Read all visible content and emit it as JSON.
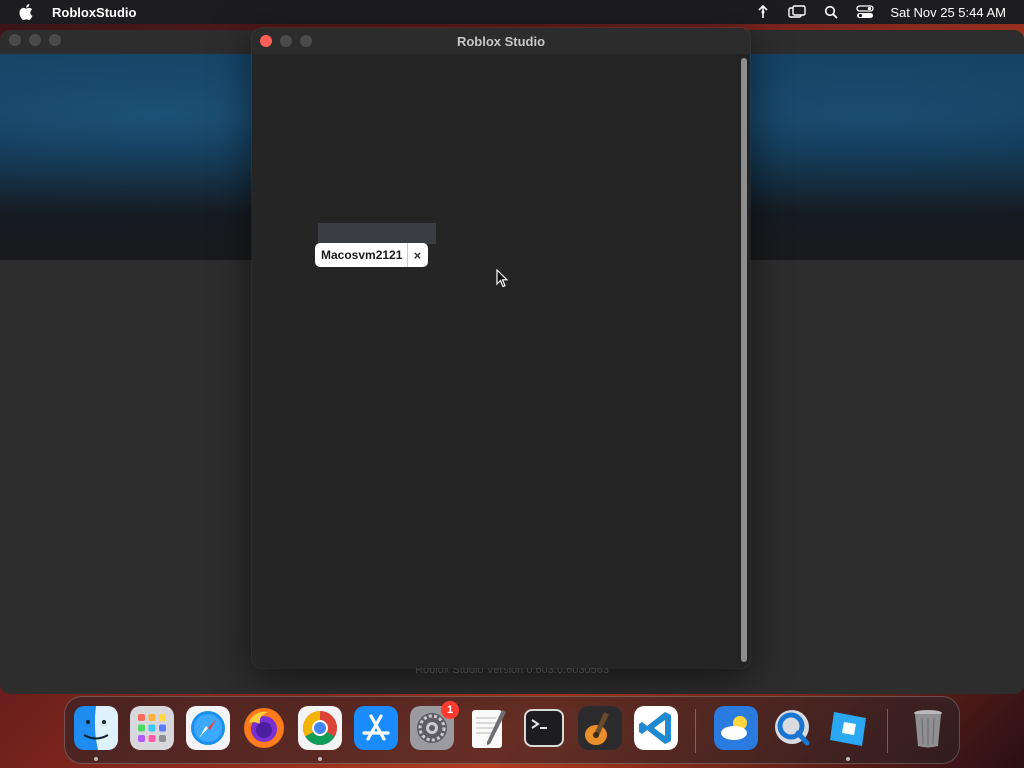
{
  "menubar": {
    "app_name": "RobloxStudio",
    "clock": "Sat Nov 25  5:44 AM",
    "icons": [
      "apple-icon",
      "stats-icon",
      "screen-mirroring-icon",
      "spotlight-search-icon",
      "control-center-icon"
    ]
  },
  "login_window": {
    "title": "Roblox Studio",
    "account_chip": {
      "label": "Macosvm2121",
      "remove_symbol": "×"
    }
  },
  "background_window": {
    "version_text": "Roblox Studio Version 0.603.0.6030563"
  },
  "dock": {
    "apps": [
      {
        "name": "Finder",
        "icon": "finder-icon",
        "running": true
      },
      {
        "name": "Launchpad",
        "icon": "launchpad-icon",
        "running": false
      },
      {
        "name": "Safari",
        "icon": "safari-icon",
        "running": false
      },
      {
        "name": "Firefox",
        "icon": "firefox-icon",
        "running": false
      },
      {
        "name": "Google Chrome",
        "icon": "chrome-icon",
        "running": true
      },
      {
        "name": "App Store",
        "icon": "app-store-icon",
        "running": false
      },
      {
        "name": "System Settings",
        "icon": "system-settings-icon",
        "running": false,
        "badge": "1"
      },
      {
        "name": "TextEdit",
        "icon": "textedit-icon",
        "running": false
      },
      {
        "name": "Terminal",
        "icon": "terminal-icon",
        "running": false
      },
      {
        "name": "GarageBand",
        "icon": "garageband-icon",
        "running": false
      },
      {
        "name": "Visual Studio Code",
        "icon": "vscode-icon",
        "running": false
      },
      {
        "name": "Weather",
        "icon": "weather-icon",
        "running": false
      },
      {
        "name": "QuickTime Player",
        "icon": "quicktime-icon",
        "running": false
      },
      {
        "name": "Roblox Studio",
        "icon": "roblox-studio-icon",
        "running": true
      },
      {
        "name": "Trash",
        "icon": "trash-icon",
        "running": false
      }
    ]
  },
  "colors": {
    "close_button": "#ff5f57",
    "badge": "#ff3b30",
    "window_bg": "#252526"
  }
}
